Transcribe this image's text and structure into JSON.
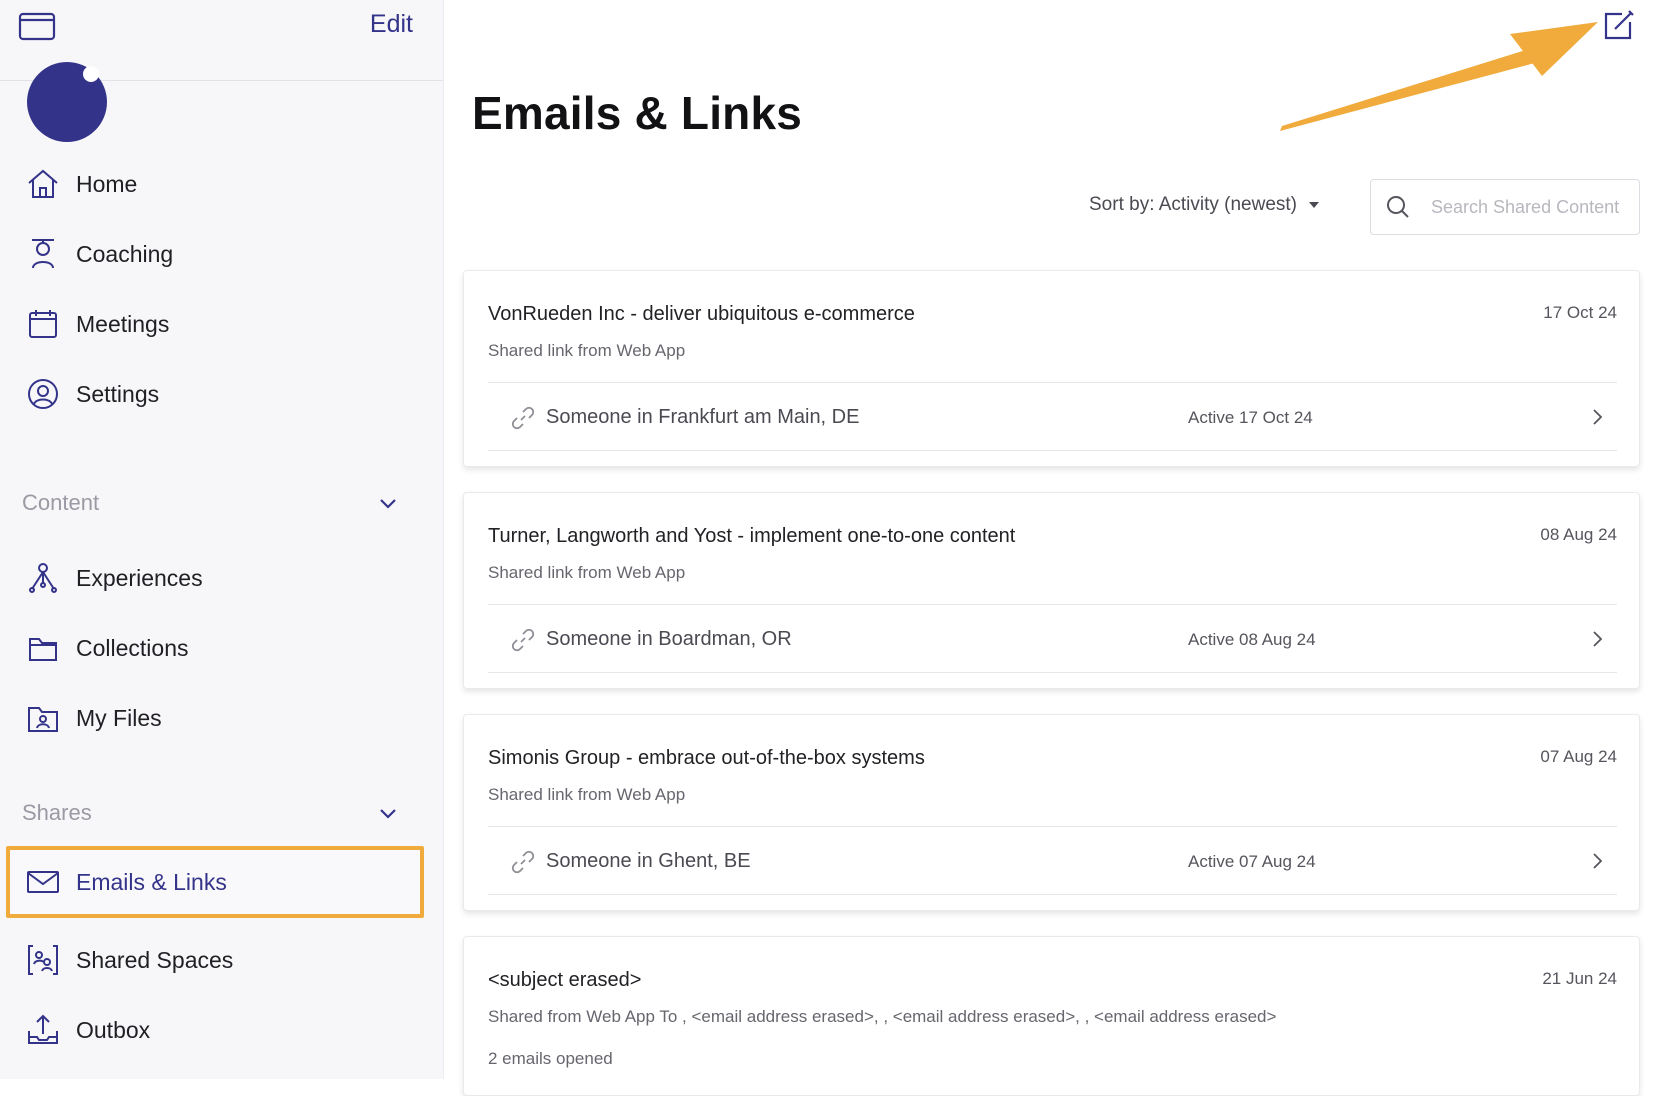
{
  "sidebar": {
    "edit_label": "Edit",
    "nav": [
      {
        "label": "Home",
        "icon": "home-icon"
      },
      {
        "label": "Coaching",
        "icon": "coaching-icon"
      },
      {
        "label": "Meetings",
        "icon": "calendar-icon"
      },
      {
        "label": "Settings",
        "icon": "user-circle-icon"
      }
    ],
    "content_section": {
      "label": "Content",
      "items": [
        {
          "label": "Experiences",
          "icon": "experiences-icon"
        },
        {
          "label": "Collections",
          "icon": "folder-icon"
        },
        {
          "label": "My Files",
          "icon": "my-files-icon"
        }
      ]
    },
    "shares_section": {
      "label": "Shares",
      "items": [
        {
          "label": "Emails & Links",
          "icon": "envelope-icon",
          "active": true
        },
        {
          "label": "Shared Spaces",
          "icon": "shared-spaces-icon"
        },
        {
          "label": "Outbox",
          "icon": "outbox-icon"
        }
      ]
    }
  },
  "main": {
    "title": "Emails & Links",
    "sort_label": "Sort by: Activity (newest)",
    "search_placeholder": "Search Shared Content",
    "cards": [
      {
        "title": "VonRueden Inc - deliver ubiquitous e-commerce",
        "date": "17 Oct 24",
        "subtitle": "Shared link from Web App",
        "recipient": "Someone in Frankfurt am Main, DE",
        "active": "Active 17 Oct 24"
      },
      {
        "title": "Turner, Langworth and Yost - implement one-to-one content",
        "date": "08 Aug 24",
        "subtitle": "Shared link from Web App",
        "recipient": "Someone in Boardman, OR",
        "active": "Active 08 Aug 24"
      },
      {
        "title": "Simonis Group - embrace out-of-the-box systems",
        "date": "07 Aug 24",
        "subtitle": "Shared link from Web App",
        "recipient": "Someone in Ghent, BE",
        "active": "Active 07 Aug 24"
      },
      {
        "title": "<subject erased>",
        "date": "21 Jun 24",
        "subtitle": "Shared from Web App To , <email address erased>, , <email address erased>, , <email address erased>",
        "opened": "2 emails opened"
      }
    ]
  },
  "colors": {
    "accent": "#34338a",
    "highlight": "#f0ab3c",
    "annotation_arrow": "#f0ab3c"
  }
}
